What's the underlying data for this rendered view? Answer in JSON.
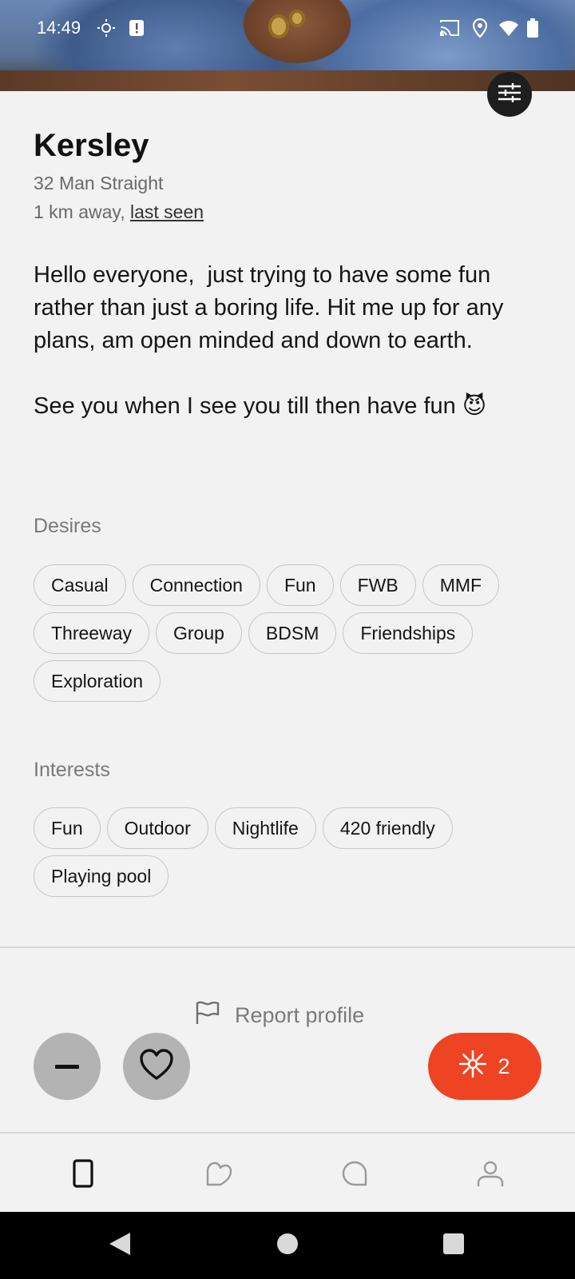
{
  "status_bar": {
    "time": "14:49",
    "icons": [
      "brightness-icon",
      "alert-icon",
      "cast-icon",
      "location-icon",
      "wifi-icon",
      "battery-icon"
    ]
  },
  "profile": {
    "name": "Kersley",
    "summary": "32 Man Straight",
    "distance": "1 km away,",
    "last_seen": "last seen",
    "bio": "Hello everyone,  just trying to have some fun rather than just a boring life. Hit me up for any plans, am open minded and down to earth.\n\nSee you when I see you till then have fun 😈"
  },
  "desires": {
    "title": "Desires",
    "items": [
      "Casual",
      "Connection",
      "Fun",
      "FWB",
      "MMF",
      "Threeway",
      "Group",
      "BDSM",
      "Friendships",
      "Exploration"
    ]
  },
  "interests": {
    "title": "Interests",
    "items": [
      "Fun",
      "Outdoor",
      "Nightlife",
      "420 friendly",
      "Playing pool"
    ]
  },
  "report": {
    "label": "Report profile"
  },
  "actions": {
    "boost_count": "2"
  },
  "colors": {
    "accent": "#ef4423",
    "background": "#f2f2f2",
    "muted": "#7a7a7a",
    "chip_border": "#c7c7c7"
  },
  "bottom_nav": [
    "cards-icon",
    "likes-icon",
    "chat-icon",
    "profile-icon"
  ]
}
